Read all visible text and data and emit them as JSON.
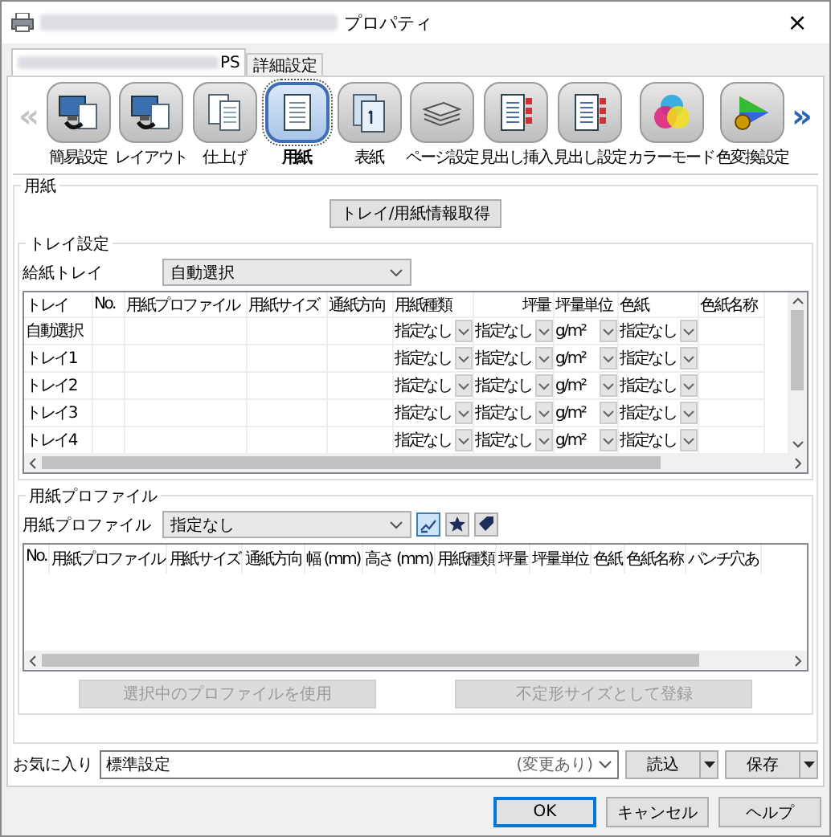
{
  "window": {
    "title": "プロパティ",
    "close": "×"
  },
  "tabs": [
    {
      "label": "PS",
      "selected": true,
      "blurred_prefix": true
    },
    {
      "label": "詳細設定",
      "selected": false,
      "blurred_prefix": false
    }
  ],
  "toolbar": {
    "prev": "«",
    "next": "»",
    "items": [
      {
        "label": "簡易設定",
        "selected": false
      },
      {
        "label": "レイアウト",
        "selected": false
      },
      {
        "label": "仕上げ",
        "selected": false
      },
      {
        "label": "用紙",
        "selected": true
      },
      {
        "label": "表紙",
        "selected": false
      },
      {
        "label": "ページ設定",
        "selected": false
      },
      {
        "label": "見出し挿入",
        "selected": false
      },
      {
        "label": "見出し設定",
        "selected": false
      },
      {
        "label": "カラーモード",
        "selected": false
      },
      {
        "label": "色変換設定",
        "selected": false
      }
    ]
  },
  "paper": {
    "title": "用紙",
    "fetch_button": "トレイ/用紙情報取得",
    "tray_settings": {
      "title": "トレイ設定",
      "source_label": "給紙トレイ",
      "source_value": "自動選択",
      "table": {
        "columns": [
          "トレイ",
          "No.",
          "用紙プロファイル",
          "用紙サイズ",
          "通紙方向",
          "用紙種類",
          "坪量",
          "坪量単位",
          "色紙",
          "色紙名称"
        ],
        "rows": [
          {
            "tray": "自動選択",
            "paper_type": "指定なし",
            "weight": "指定なし",
            "weight_unit": "g/m²",
            "color_paper": "指定なし"
          },
          {
            "tray": "トレイ1",
            "paper_type": "指定なし",
            "weight": "指定なし",
            "weight_unit": "g/m²",
            "color_paper": "指定なし"
          },
          {
            "tray": "トレイ2",
            "paper_type": "指定なし",
            "weight": "指定なし",
            "weight_unit": "g/m²",
            "color_paper": "指定なし"
          },
          {
            "tray": "トレイ3",
            "paper_type": "指定なし",
            "weight": "指定なし",
            "weight_unit": "g/m²",
            "color_paper": "指定なし"
          },
          {
            "tray": "トレイ4",
            "paper_type": "指定なし",
            "weight": "指定なし",
            "weight_unit": "g/m²",
            "color_paper": "指定なし"
          }
        ]
      }
    },
    "profile": {
      "title": "用紙プロファイル",
      "label": "用紙プロファイル",
      "value": "指定なし",
      "tools": [
        {
          "selected": true
        },
        {
          "selected": false
        },
        {
          "selected": false
        }
      ],
      "table": {
        "columns": [
          "No.",
          "用紙プロファイル",
          "用紙サイズ",
          "通紙方向",
          "幅 (mm)",
          "高さ (mm)",
          "用紙種類",
          "坪量",
          "坪量単位",
          "色紙",
          "色紙名称",
          "パンチ穴あ"
        ]
      },
      "buttons": [
        {
          "label": "選択中のプロファイルを使用",
          "disabled": true
        },
        {
          "label": "不定形サイズとして登録",
          "disabled": true
        }
      ]
    }
  },
  "favorites": {
    "label": "お気に入り",
    "value": "標準設定",
    "note": "(変更あり)",
    "buttons": [
      "読込",
      "保存"
    ]
  },
  "buttons": [
    {
      "label": "OK",
      "default": true
    },
    {
      "label": "キャンセル",
      "default": false
    },
    {
      "label": "ヘルプ",
      "default": false
    }
  ]
}
